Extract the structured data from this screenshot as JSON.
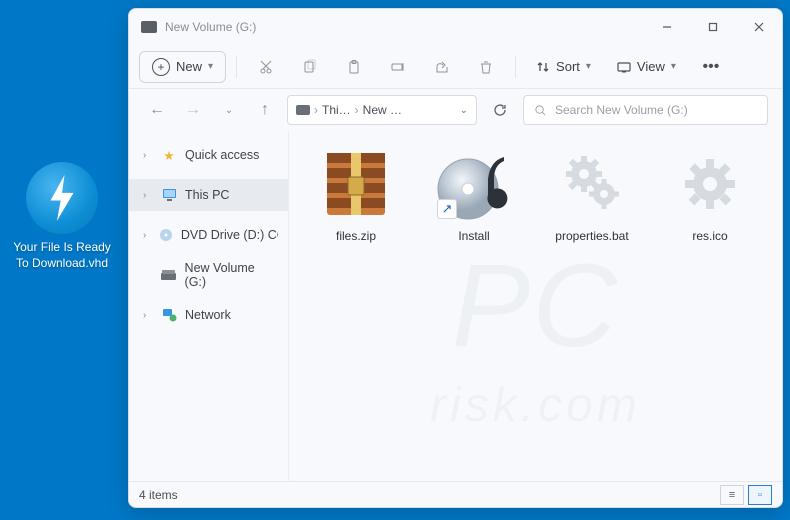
{
  "desktop": {
    "label": "Your File Is Ready To Download.vhd"
  },
  "window": {
    "title": "New Volume (G:)",
    "toolbar": {
      "new_label": "New",
      "sort_label": "Sort",
      "view_label": "View",
      "icons": [
        "cut-icon",
        "copy-icon",
        "paste-icon",
        "rename-icon",
        "share-icon",
        "delete-icon"
      ]
    },
    "breadcrumb": {
      "seg1": "Thi…",
      "seg2": "New …"
    },
    "search": {
      "placeholder": "Search New Volume (G:)"
    },
    "sidebar": {
      "items": [
        {
          "label": "Quick access",
          "icon": "star-icon",
          "selected": false
        },
        {
          "label": "This PC",
          "icon": "monitor-icon",
          "selected": true
        },
        {
          "label": "DVD Drive (D:) CCCC",
          "icon": "disc-icon",
          "selected": false
        },
        {
          "label": "New Volume (G:)",
          "icon": "drive-icon",
          "selected": false
        },
        {
          "label": "Network",
          "icon": "network-icon",
          "selected": false
        }
      ]
    },
    "files": [
      {
        "name": "files.zip",
        "type": "archive",
        "shortcut": false
      },
      {
        "name": "Install",
        "type": "disc-audio",
        "shortcut": true
      },
      {
        "name": "properties.bat",
        "type": "gear",
        "shortcut": false
      },
      {
        "name": "res.ico",
        "type": "gear",
        "shortcut": false
      }
    ],
    "status": "4 items"
  },
  "watermark": {
    "top": "PC",
    "bottom": "risk.com"
  }
}
